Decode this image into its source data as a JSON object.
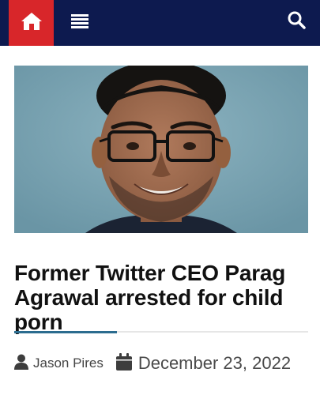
{
  "header": {
    "icons": {
      "home": "home-icon",
      "menu": "menu-icon",
      "search": "search-icon"
    },
    "colors": {
      "bar": "#0d1a4f",
      "home_button": "#d8262a"
    }
  },
  "article": {
    "title": "Former Twitter CEO Parag Agrawal arrested for child porn",
    "author": "Jason Pires",
    "date": "December 23, 2022",
    "accent_color": "#2b6c8f"
  }
}
